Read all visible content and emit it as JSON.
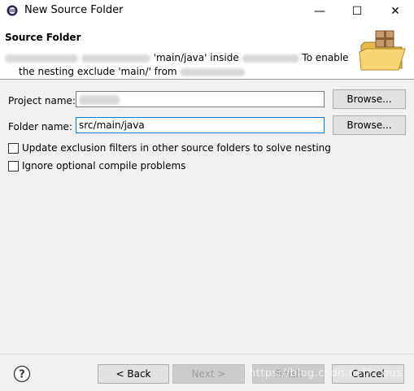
{
  "window": {
    "title": "New Source Folder",
    "minimize_glyph": "—",
    "maximize_glyph": "☐",
    "close_glyph": "✕"
  },
  "banner": {
    "title": "Source Folder",
    "message_line1_prefix": "",
    "message_line1_mid": "'main/java' inside",
    "message_line1_suffix": "To enable",
    "message_line2_prefix": "the nesting exclude 'main/' from",
    "icon": "source-folder-icon"
  },
  "form": {
    "project_label": "Project name:",
    "project_value": "",
    "folder_label": "Folder name:",
    "folder_value": "src/main/java",
    "browse_label": "Browse...",
    "update_exclusion_label": "Update exclusion filters in other source folders to solve nesting",
    "update_exclusion_checked": false,
    "ignore_problems_label": "Ignore optional compile problems",
    "ignore_problems_checked": false
  },
  "footer": {
    "back_label": "< Back",
    "next_label": "Next >",
    "finish_label": "Finish",
    "cancel_label": "Cancel",
    "watermark": "https://blog.csdn.net/...ous"
  },
  "colors": {
    "focus_border": "#0078d7",
    "dialog_bg": "#f0f0f0"
  }
}
